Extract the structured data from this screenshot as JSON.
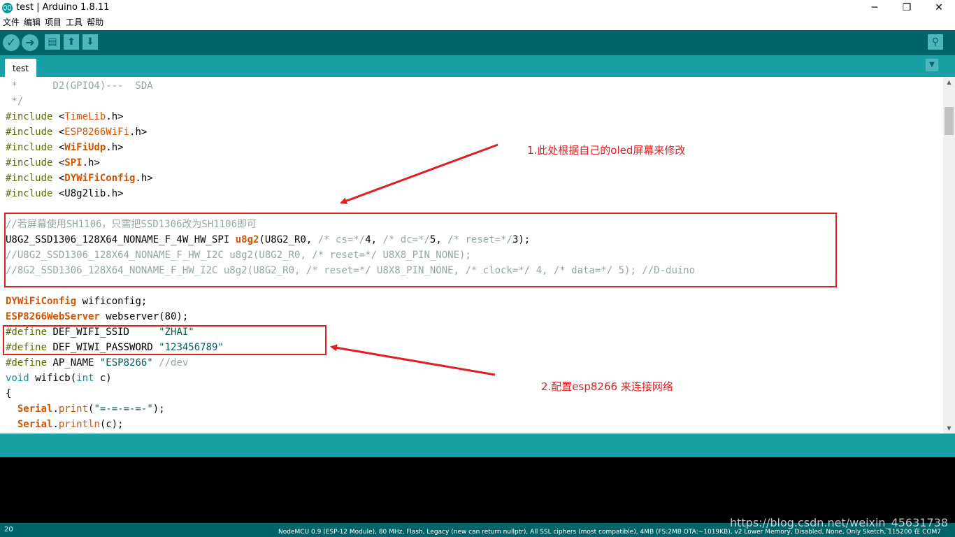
{
  "window": {
    "title": "test | Arduino 1.8.11",
    "minimize": "─",
    "maximize": "❐",
    "close": "✕"
  },
  "menu": [
    "文件",
    "编辑",
    "项目",
    "工具",
    "帮助"
  ],
  "toolbar": {
    "verify": "✓",
    "upload": "➜",
    "new": "▤",
    "open": "⬆",
    "save": "⬇",
    "serial_monitor": "⚲"
  },
  "tabs": {
    "active": "test",
    "menu": "▼"
  },
  "code": [
    [
      {
        "t": " *      D2(GPIO4)---  SDA",
        "c": "cmt"
      }
    ],
    [
      {
        "t": " */",
        "c": "cmt"
      }
    ],
    [
      {
        "t": "#include ",
        "c": "kw-pre"
      },
      {
        "t": "<"
      },
      {
        "t": "TimeLib",
        "c": "kw-lib"
      },
      {
        "t": ".h>"
      }
    ],
    [
      {
        "t": "#include ",
        "c": "kw-pre"
      },
      {
        "t": "<"
      },
      {
        "t": "ESP8266WiFi",
        "c": "kw-lib"
      },
      {
        "t": ".h>"
      }
    ],
    [
      {
        "t": "#include ",
        "c": "kw-pre"
      },
      {
        "t": "<"
      },
      {
        "t": "WiFiUdp",
        "c": "kw-bold"
      },
      {
        "t": ".h>"
      }
    ],
    [
      {
        "t": "#include ",
        "c": "kw-pre"
      },
      {
        "t": "<"
      },
      {
        "t": "SPI",
        "c": "kw-bold"
      },
      {
        "t": ".h>"
      }
    ],
    [
      {
        "t": "#include ",
        "c": "kw-pre"
      },
      {
        "t": "<"
      },
      {
        "t": "DYWiFiConfig",
        "c": "kw-bold"
      },
      {
        "t": ".h>"
      }
    ],
    [
      {
        "t": "#include ",
        "c": "kw-pre"
      },
      {
        "t": "<U8g2lib.h>"
      }
    ],
    [],
    [
      {
        "t": "//若屏幕使用SH1106，只需把SSD1306改为SH1106即可",
        "c": "cmt"
      }
    ],
    [
      {
        "t": "U8G2_SSD1306_128X64_NONAME_F_4W_HW_SPI "
      },
      {
        "t": "u8g2",
        "c": "kw-bold"
      },
      {
        "t": "(U8G2_R0, "
      },
      {
        "t": "/* cs=*/",
        "c": "cmt"
      },
      {
        "t": "4, "
      },
      {
        "t": "/* dc=*/",
        "c": "cmt"
      },
      {
        "t": "5, "
      },
      {
        "t": "/* reset=*/",
        "c": "cmt"
      },
      {
        "t": "3);"
      }
    ],
    [
      {
        "t": "//U8G2_SSD1306_128X64_NONAME_F_HW_I2C u8g2(U8G2_R0, /* reset=*/ U8X8_PIN_NONE);",
        "c": "cmt"
      }
    ],
    [
      {
        "t": "//8G2_SSD1306_128X64_NONAME_F_HW_I2C u8g2(U8G2_R0, /* reset=*/ U8X8_PIN_NONE, /* clock=*/ 4, /* data=*/ 5); //D-duino",
        "c": "cmt"
      }
    ],
    [],
    [
      {
        "t": "DYWiFiConfig",
        "c": "kw-bold"
      },
      {
        "t": " wificonfig;"
      }
    ],
    [
      {
        "t": "ESP8266WebServer",
        "c": "kw-bold"
      },
      {
        "t": " webserver(80);"
      }
    ],
    [
      {
        "t": "#define ",
        "c": "kw-pre"
      },
      {
        "t": "DEF_WIFI_SSID     "
      },
      {
        "t": "\"ZHAI\"",
        "c": "str"
      }
    ],
    [
      {
        "t": "#define ",
        "c": "kw-pre"
      },
      {
        "t": "DEF_WIWI_PASSWORD "
      },
      {
        "t": "\"123456789\"",
        "c": "str"
      }
    ],
    [
      {
        "t": "#define ",
        "c": "kw-pre"
      },
      {
        "t": "AP_NAME "
      },
      {
        "t": "\"ESP8266\"",
        "c": "str"
      },
      {
        "t": " //dev",
        "c": "cmt"
      }
    ],
    [
      {
        "t": "void",
        "c": "kw-type"
      },
      {
        "t": " wificb("
      },
      {
        "t": "int",
        "c": "kw-type"
      },
      {
        "t": " c)"
      }
    ],
    [
      {
        "t": "{"
      }
    ],
    [
      {
        "t": "  "
      },
      {
        "t": "Serial",
        "c": "kw-bold"
      },
      {
        "t": "."
      },
      {
        "t": "print",
        "c": "kw-lib"
      },
      {
        "t": "("
      },
      {
        "t": "\"=-=-=-=-\"",
        "c": "str"
      },
      {
        "t": ");"
      }
    ],
    [
      {
        "t": "  "
      },
      {
        "t": "Serial",
        "c": "kw-bold"
      },
      {
        "t": "."
      },
      {
        "t": "println",
        "c": "kw-lib"
      },
      {
        "t": "(c);"
      }
    ]
  ],
  "annotations": {
    "note1": "1.此处根据自己的oled屏幕来修改",
    "note2": "2.配置esp8266 来连接网络"
  },
  "colors": {
    "annotation": "#e02020",
    "toolbar": "#006468",
    "tabbar": "#17a1a5"
  },
  "statusbar": {
    "line": "20",
    "board": "NodeMCU 0.9 (ESP-12 Module), 80 MHz, Flash, Legacy (new can return nullptr), All SSL ciphers (most compatible), 4MB (FS:2MB OTA:~1019KB), v2 Lower Memory, Disabled, None, Only Sketch, 115200 在 COM7",
    "watermark": "https://blog.csdn.net/weixin_45631738"
  }
}
